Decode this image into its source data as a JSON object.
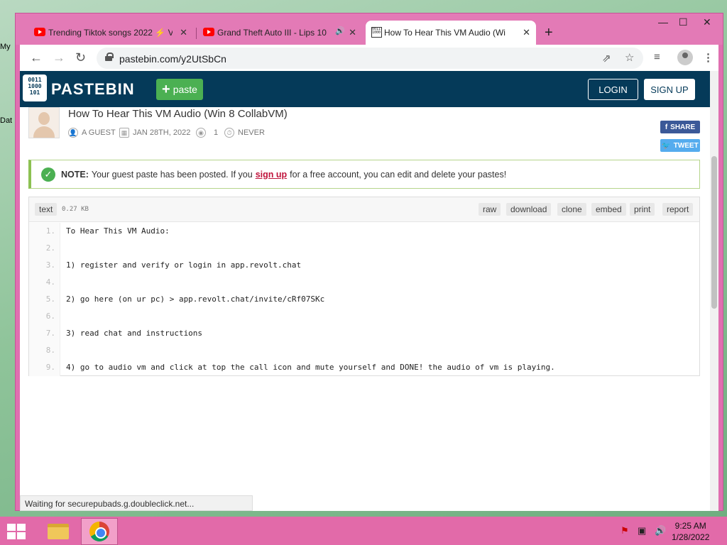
{
  "desktop": {
    "icon_labels": [
      "My",
      "Dat"
    ]
  },
  "browser": {
    "tabs": [
      {
        "title": "Trending Tiktok songs 2022 ⚡ V",
        "icon": "youtube-icon",
        "active": false
      },
      {
        "title": "Grand Theft Auto III - Lips 10",
        "icon": "youtube-icon",
        "active": false,
        "audio": true
      },
      {
        "title": "How To Hear This VM Audio (Wi",
        "icon": "pastebin-icon",
        "active": true
      }
    ],
    "url": "pastebin.com/y2UtSbCn",
    "status_text": "Waiting for securepubads.g.doubleclick.net..."
  },
  "pastebin": {
    "brand": "PASTEBIN",
    "logo_text": "0011 1000 101",
    "paste_button": "paste",
    "login": "LOGIN",
    "signup": "SIGN UP",
    "paste": {
      "title": "How To Hear This VM Audio (Win 8 CollabVM)",
      "author": "A GUEST",
      "date": "JAN 28TH, 2022",
      "views": "1",
      "expiry": "NEVER"
    },
    "share": "SHARE",
    "tweet": "TWEET",
    "notice": {
      "label": "NOTE:",
      "text_before": "Your guest paste has been posted. If you",
      "link": "sign up",
      "text_after": "for a free account, you can edit and delete your pastes!"
    },
    "code": {
      "syntax": "text",
      "size": "0.27 KB",
      "actions": [
        "raw",
        "download",
        "clone",
        "embed",
        "print",
        "report"
      ],
      "lines": [
        {
          "n": "1.",
          "text": "To Hear This VM Audio:"
        },
        {
          "n": "2.",
          "text": ""
        },
        {
          "n": "3.",
          "text": "1) register and verify or login in app.revolt.chat"
        },
        {
          "n": "4.",
          "text": ""
        },
        {
          "n": "5.",
          "text": "2) go here (on ur pc) > app.revolt.chat/invite/cRf07SKc"
        },
        {
          "n": "6.",
          "text": ""
        },
        {
          "n": "7.",
          "text": "3) read chat and instructions"
        },
        {
          "n": "8.",
          "text": ""
        },
        {
          "n": "9.",
          "text": "4) go to audio vm and click at top the call icon and mute yourself and DONE! the audio of vm is playing."
        }
      ]
    }
  },
  "taskbar": {
    "time": "9:25 AM",
    "date": "1/28/2022"
  },
  "colors": {
    "window_frame": "#e06fb0",
    "pastebin_header": "#053a59",
    "paste_green": "#4bb052",
    "link_red": "#c0143c"
  }
}
